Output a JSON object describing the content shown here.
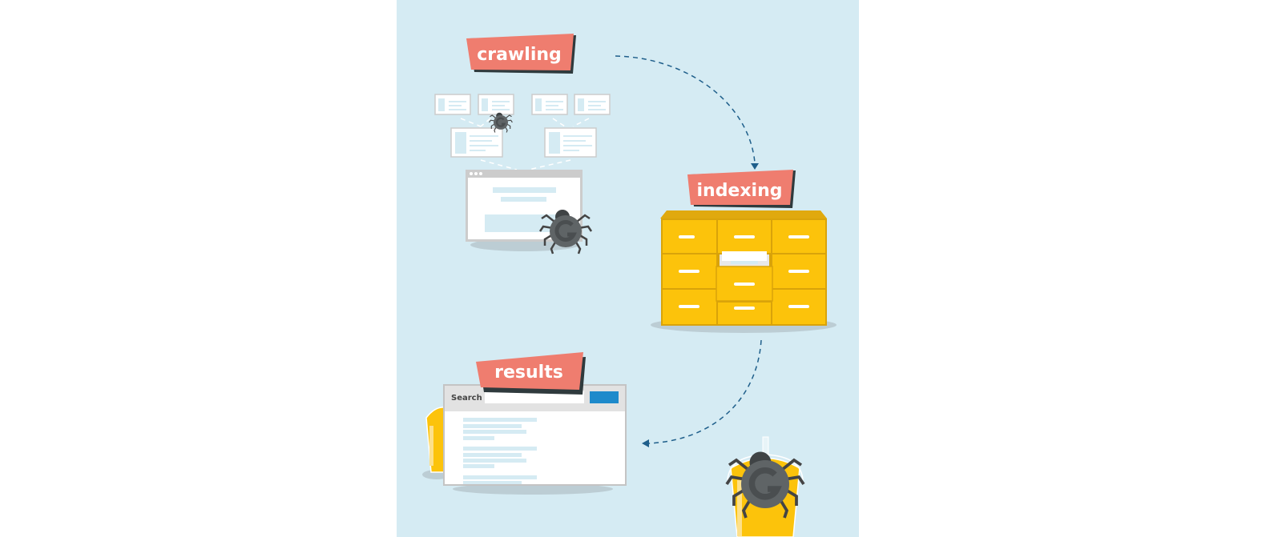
{
  "stages": {
    "crawling": "crawling",
    "indexing": "indexing",
    "results": "results"
  },
  "results_page": {
    "search_label": "Search"
  },
  "colors": {
    "background": "#d5ebf3",
    "banner": "#ef7d6f",
    "cabinet": "#fcc30b",
    "search_button": "#1e8acb",
    "spider": "#5f6466",
    "arrow": "#1f5f8b"
  },
  "icons": [
    "spider-icon",
    "browser-window-icon",
    "filing-cabinet-icon",
    "cup-icon"
  ]
}
